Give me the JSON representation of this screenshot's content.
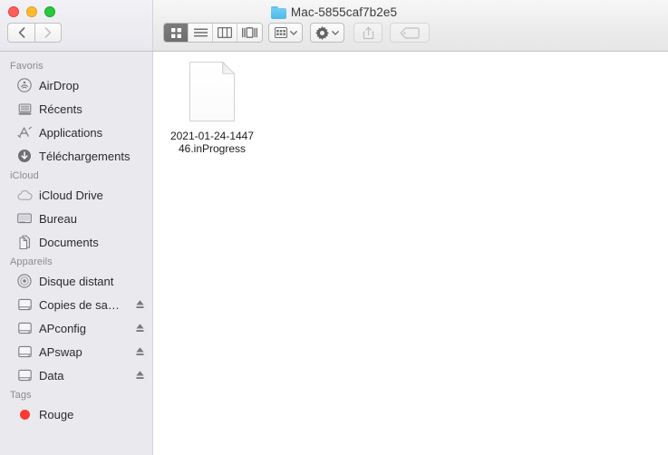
{
  "window": {
    "title": "Mac-5855caf7b2e5",
    "folder_icon": "folder-icon",
    "traffic_lights": [
      {
        "name": "close-button",
        "color": "#ff5f57",
        "label": "Fermer"
      },
      {
        "name": "minimize-button",
        "color": "#febc2e",
        "label": "Réduire"
      },
      {
        "name": "maximize-button",
        "color": "#28c840",
        "label": "Agrandir"
      }
    ]
  },
  "toolbar": {
    "nav": {
      "back": {
        "icon": "chevron-left-icon",
        "enabled": true
      },
      "forward": {
        "icon": "chevron-right-icon",
        "enabled": false
      }
    },
    "view_modes": [
      {
        "id": "icon",
        "icon": "grid-view-icon",
        "selected": true
      },
      {
        "id": "list",
        "icon": "list-view-icon",
        "selected": false
      },
      {
        "id": "column",
        "icon": "column-view-icon",
        "selected": false
      },
      {
        "id": "gallery",
        "icon": "gallery-view-icon",
        "selected": false
      }
    ],
    "arrange": {
      "icon": "arrange-icon",
      "chevron": "chevron-down-icon",
      "enabled": true
    },
    "action": {
      "icon": "gear-icon",
      "chevron": "chevron-down-icon",
      "enabled": true
    },
    "share": {
      "icon": "share-icon",
      "enabled": false
    },
    "tags": {
      "icon": "tag-icon",
      "enabled": false
    }
  },
  "sidebar": {
    "sections": [
      {
        "title": "Favoris",
        "items": [
          {
            "label": "AirDrop",
            "icon": "airdrop-icon",
            "eject": false
          },
          {
            "label": "Récents",
            "icon": "recents-icon",
            "eject": false
          },
          {
            "label": "Applications",
            "icon": "applications-icon",
            "eject": false
          },
          {
            "label": "Téléchargements",
            "icon": "downloads-icon",
            "eject": false
          }
        ]
      },
      {
        "title": "iCloud",
        "items": [
          {
            "label": "iCloud Drive",
            "icon": "cloud-icon",
            "eject": false
          },
          {
            "label": "Bureau",
            "icon": "desktop-icon",
            "eject": false
          },
          {
            "label": "Documents",
            "icon": "documents-icon",
            "eject": false
          }
        ]
      },
      {
        "title": "Appareils",
        "items": [
          {
            "label": "Disque distant",
            "icon": "disc-icon",
            "eject": false
          },
          {
            "label": "Copies de sa…",
            "icon": "hard-drive-icon",
            "eject": true
          },
          {
            "label": "APconfig",
            "icon": "hard-drive-icon",
            "eject": true
          },
          {
            "label": "APswap",
            "icon": "hard-drive-icon",
            "eject": true
          },
          {
            "label": "Data",
            "icon": "hard-drive-icon",
            "eject": true
          }
        ]
      },
      {
        "title": "Tags",
        "items": [
          {
            "label": "Rouge",
            "icon": "tag-dot-icon",
            "color": "#fc3b30",
            "eject": false
          }
        ]
      }
    ]
  },
  "content": {
    "files": [
      {
        "name_line1": "2021-01-24-1447",
        "name_line2": "46.inProgress",
        "full_name": "2021-01-24-144746.inProgress",
        "icon": "blank-document-icon",
        "selected": false
      }
    ]
  },
  "colors": {
    "sidebar_bg": "#eaeaee",
    "content_bg": "#ffffff",
    "toolbar_top": "#f7f7f7",
    "toolbar_bottom": "#e6e6e6",
    "section_header": "#8a8a8f",
    "label_text": "#2b2b2b",
    "selected_segment": "#737373",
    "folder_blue": "#4fb9e8",
    "tag_red": "#fc3b30"
  }
}
